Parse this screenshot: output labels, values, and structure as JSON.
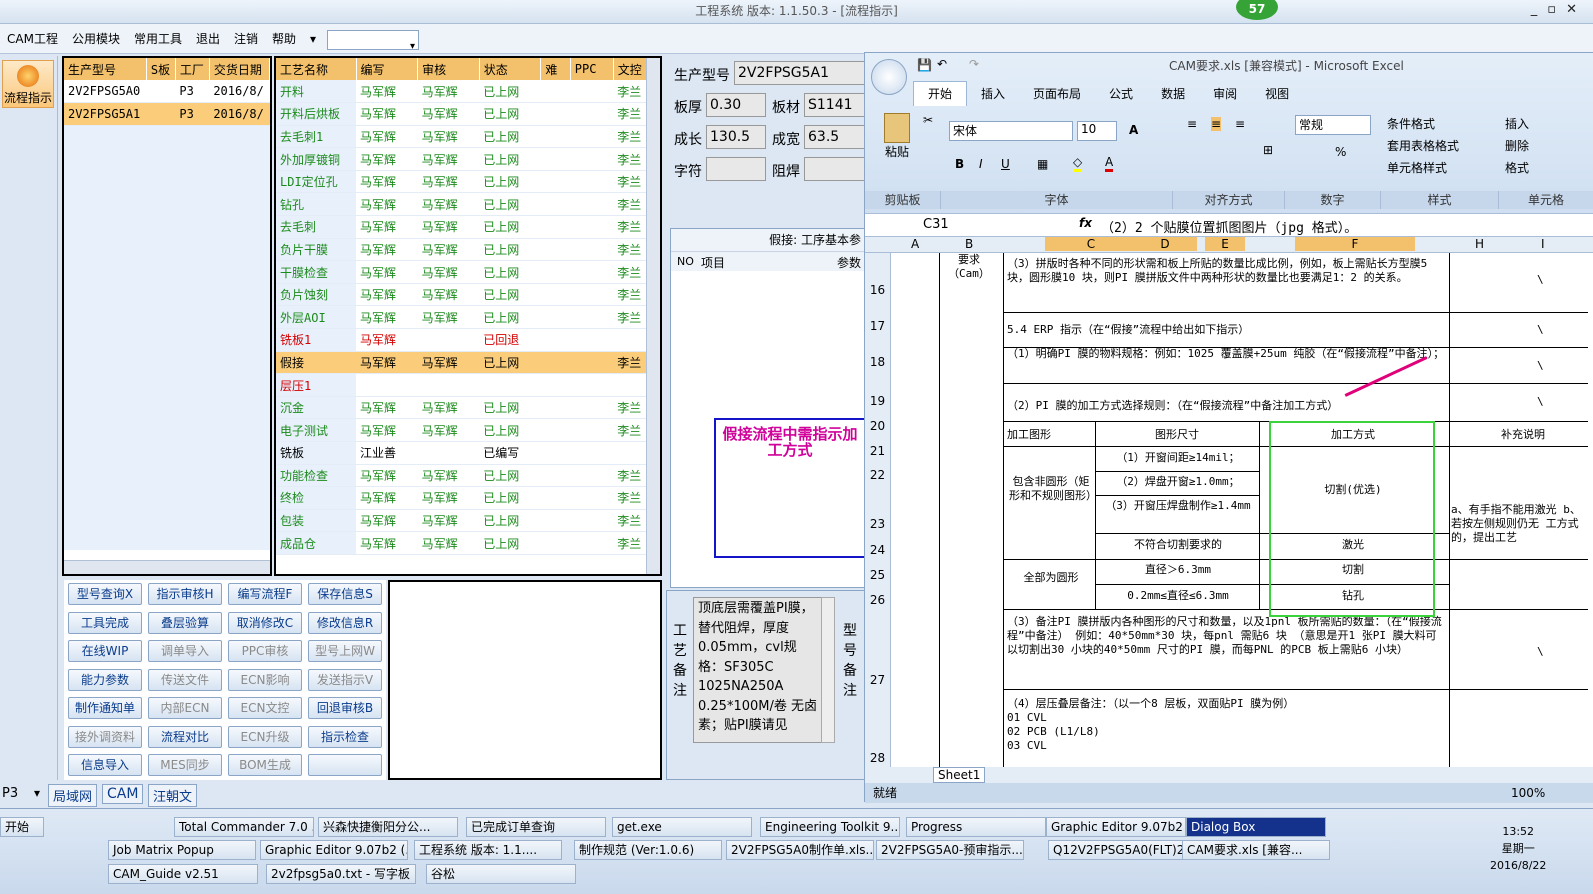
{
  "window": {
    "title": "工程系统  版本: 1.1.50.3 - [流程指示]",
    "badge": "57"
  },
  "menu": [
    "CAM工程",
    "公用模块",
    "常用工具",
    "退出",
    "注销",
    "帮助"
  ],
  "left_tool": {
    "flow_label": "流程指示"
  },
  "models": {
    "headers": [
      "生产型号",
      "S板",
      "工厂",
      "交货日期"
    ],
    "rows": [
      [
        "2V2FPSG5A0",
        "",
        "P3",
        "2016/8/"
      ],
      [
        "2V2FPSG5A1",
        "",
        "P3",
        "2016/8/"
      ]
    ]
  },
  "process": {
    "headers": [
      "工艺名称",
      "编写",
      "审核",
      "状态",
      "难",
      "PPC",
      "文控"
    ],
    "rows": [
      {
        "n": "开料",
        "a": "马军辉",
        "b": "马军辉",
        "s": "已上网",
        "d": "李兰",
        "c": "g"
      },
      {
        "n": "开料后烘板",
        "a": "马军辉",
        "b": "马军辉",
        "s": "已上网",
        "d": "李兰",
        "c": "g"
      },
      {
        "n": "去毛刺1",
        "a": "马军辉",
        "b": "马军辉",
        "s": "已上网",
        "d": "李兰",
        "c": "g"
      },
      {
        "n": "外加厚镀铜",
        "a": "马军辉",
        "b": "马军辉",
        "s": "已上网",
        "d": "李兰",
        "c": "g"
      },
      {
        "n": "LDI定位孔",
        "a": "马军辉",
        "b": "马军辉",
        "s": "已上网",
        "d": "李兰",
        "c": "g"
      },
      {
        "n": "钻孔",
        "a": "马军辉",
        "b": "马军辉",
        "s": "已上网",
        "d": "李兰",
        "c": "g"
      },
      {
        "n": "去毛刺",
        "a": "马军辉",
        "b": "马军辉",
        "s": "已上网",
        "d": "李兰",
        "c": "g"
      },
      {
        "n": "负片干膜",
        "a": "马军辉",
        "b": "马军辉",
        "s": "已上网",
        "d": "李兰",
        "c": "g"
      },
      {
        "n": "干膜检查",
        "a": "马军辉",
        "b": "马军辉",
        "s": "已上网",
        "d": "李兰",
        "c": "g"
      },
      {
        "n": "负片蚀刻",
        "a": "马军辉",
        "b": "马军辉",
        "s": "已上网",
        "d": "李兰",
        "c": "g"
      },
      {
        "n": "外层AOI",
        "a": "马军辉",
        "b": "马军辉",
        "s": "已上网",
        "d": "李兰",
        "c": "g"
      },
      {
        "n": "铣板1",
        "a": "马军辉",
        "b": "",
        "s": "已回退",
        "d": "",
        "c": "r"
      },
      {
        "n": "假接",
        "a": "马军辉",
        "b": "马军辉",
        "s": "已上网",
        "d": "李兰",
        "c": "sel"
      },
      {
        "n": "层压1",
        "a": "",
        "b": "",
        "s": "",
        "d": "",
        "c": "r"
      },
      {
        "n": "沉金",
        "a": "马军辉",
        "b": "马军辉",
        "s": "已上网",
        "d": "李兰",
        "c": "g"
      },
      {
        "n": "电子测试",
        "a": "马军辉",
        "b": "马军辉",
        "s": "已上网",
        "d": "李兰",
        "c": "g"
      },
      {
        "n": "铣板",
        "a": "江业善",
        "b": "",
        "s": "已编写",
        "d": "",
        "c": "k"
      },
      {
        "n": "功能检查",
        "a": "马军辉",
        "b": "马军辉",
        "s": "已上网",
        "d": "李兰",
        "c": "g"
      },
      {
        "n": "终检",
        "a": "马军辉",
        "b": "马军辉",
        "s": "已上网",
        "d": "李兰",
        "c": "g"
      },
      {
        "n": "包装",
        "a": "马军辉",
        "b": "马军辉",
        "s": "已上网",
        "d": "李兰",
        "c": "g"
      },
      {
        "n": "成品仓",
        "a": "马军辉",
        "b": "马军辉",
        "s": "已上网",
        "d": "李兰",
        "c": "g"
      }
    ]
  },
  "buttons": [
    [
      "型号查询X",
      "指示审核H",
      "编写流程F",
      "保存信息S"
    ],
    [
      "工具完成",
      "叠层验算",
      "取消修改C",
      "修改信息R"
    ],
    [
      "在线WIP",
      "调单导入",
      "PPC审核",
      "型号上网W"
    ],
    [
      "能力参数",
      "传送文件",
      "ECN影响",
      "发送指示V"
    ],
    [
      "制作通知单",
      "内部ECN",
      "ECN文控",
      "回退审核B"
    ],
    [
      "接外调资料",
      "流程对比",
      "ECN升级",
      "指示检查"
    ],
    [
      "信息导入",
      "MES同步",
      "BOM生成",
      ""
    ]
  ],
  "disabled": [
    "调单导入",
    "PPC审核",
    "型号上网W",
    "传送文件",
    "ECN影响",
    "发送指示V",
    "内部ECN",
    "ECN文控",
    "接外调资料",
    "ECN升级",
    "MES同步",
    "BOM生成"
  ],
  "detail": {
    "model_label": "生产型号",
    "model": "2V2FPSG5A1",
    "thick_label": "板厚",
    "thick": "0.30",
    "mat_label": "板材",
    "mat": "S1141",
    "len_label": "成长",
    "len": "130.5",
    "wid_label": "成宽",
    "wid": "63.5",
    "char_label": "字符",
    "mask_label": "阻焊",
    "step_title": "假接: 工序基本参",
    "col_no": "NO",
    "col_item": "项目",
    "col_param": "参数",
    "note_box": "假接流程中需指示加工方式",
    "remark_label": "工艺备注",
    "remark": "顶底层需覆盖PI膜，替代阻焊，厚度0.05mm，cvl规格：SF305C 1025NA250A 0.25*100M/卷 无卤素；贴PI膜请见",
    "model_remark_label": "型号备注"
  },
  "status": {
    "combo": "P3",
    "items": [
      "局域网",
      "CAM",
      "汪朝文"
    ]
  },
  "excel": {
    "title": "CAM要求.xls [兼容模式] - Microsoft Excel",
    "tabs": [
      "开始",
      "插入",
      "页面布局",
      "公式",
      "数据",
      "审阅",
      "视图"
    ],
    "font": "宋体",
    "size": "10",
    "number_format": "常规",
    "groups": [
      "剪贴板",
      "字体",
      "对齐方式",
      "数字",
      "样式",
      "单元格"
    ],
    "paste": "粘贴",
    "styles": [
      "条件格式",
      "套用表格格式",
      "单元格样式"
    ],
    "cells": [
      "插入",
      "删除",
      "格式"
    ],
    "cellref": "C31",
    "formula": "（2）2 个贴膜位置抓图图片（jpg 格式）。",
    "cols": [
      "A",
      "B",
      "C",
      "D",
      "E",
      "F",
      "H",
      "I"
    ],
    "b_label": "要求（Cam）",
    "r16": "（3）拼版时各种不同的形状需和板上所贴的数量比成比例，例如，板上需贴长方型膜5 块，圆形膜10 块，则PI 膜拼版文件中两种形状的数量比也要满足1：2 的关系。",
    "r17": "5.4 ERP 指示（在“假接”流程中给出如下指示）",
    "r18": "（1）明确PI 膜的物料规格：例如：1025 覆盖膜+25um 纯胶（在“假接流程”中备注）；",
    "r19": "（2）PI 膜的加工方式选择规则：（在“假接流程”中备注加工方式）",
    "h_shape": "加工图形",
    "h_size": "图形尺寸",
    "h_method": "加工方式",
    "h_note": "补充说明",
    "g1": "包含非圆形（矩形和不规则图形）",
    "s1": "（1）开窗间距≥14mil；",
    "s2": "（2）焊盘开窗≥1.0mm；",
    "s3": "（3）开窗压焊盘制作≥1.4mm",
    "m1": "切割(优选)",
    "s4": "不符合切割要求的",
    "m2": "激光",
    "g2": "全部为圆形",
    "s5": "直径＞6.3mm",
    "m3": "切割",
    "s6": "0.2mm≤直径≤6.3mm",
    "m4": "钻孔",
    "note_col": "a、有手指不能用激光 b、若按左侧规则仍无 工方式的，提出工艺",
    "r27": "（3）备注PI 膜拼版内各种图形的尺寸和数量，以及1pnl 板所需贴的数量：（在“假接流程”中备注） 例如：40*50mm*30 块，每pnl 需贴6 块 （意思是开1 张PI 膜大料可以切割出30 小块的40*50mm 尺寸的PI 膜，而每PNL 的PCB 板上需贴6 小块）",
    "r28": "（4）层压叠层备注：（以一个8 层板，双面贴PI 膜为例）\n01 CVL\n02 PCB (L1/L8)\n03 CVL",
    "backslash": "\\",
    "rows": [
      "16",
      "17",
      "18",
      "19",
      "20",
      "21",
      "22",
      "23",
      "24",
      "25",
      "26",
      "27",
      "28"
    ],
    "sheet": "Sheet1",
    "ready": "就绪",
    "zoom": "100%"
  },
  "taskbar": {
    "start": "开始",
    "time": "13:52",
    "weekday": "星期一",
    "date": "2016/8/22",
    "row1": [
      "Total Commander 7.0 ...",
      "兴森快捷衡阳分公...",
      "已完成订单查询",
      "get.exe",
      "Engineering Toolkit 9....",
      "Progress",
      "Graphic Editor 9.07b2 ...",
      "Dialog Box"
    ],
    "row2": [
      "Job Matrix Popup",
      "Graphic Editor 9.07b2 (...",
      "工程系统  版本: 1.1....",
      "制作规范 (Ver:1.0.6)",
      "2V2FPSG5A0制作单.xls...",
      "2V2FPSG5A0-预审指示...",
      "Q12V2FPSG5A0(FLT)20...",
      "CAM要求.xls [兼容..."
    ],
    "row3": [
      "CAM_Guide v2.51",
      "2v2fpsg5a0.txt - 写字板",
      "谷松"
    ]
  }
}
